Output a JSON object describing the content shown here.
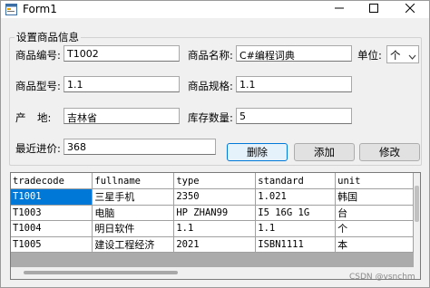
{
  "window": {
    "title": "Form1",
    "icons": {
      "app": "app-icon",
      "minimize": "minimize-icon",
      "maximize": "maximize-icon",
      "close": "close-icon"
    }
  },
  "group": {
    "title": "设置商品信息"
  },
  "form": {
    "code_label": "商品编号:",
    "code_value": "T1002",
    "name_label": "商品名称:",
    "name_value": "C#编程词典",
    "unit_label": "单位:",
    "unit_value": "个",
    "model_label": "商品型号:",
    "model_value": "1.1",
    "spec_label": "商品规格:",
    "spec_value": "1.1",
    "origin_label_1": "产",
    "origin_label_2": "地:",
    "origin_value": "吉林省",
    "stock_label": "库存数量:",
    "stock_value": "5",
    "price_label": "最近进价:",
    "price_value": "368"
  },
  "buttons": {
    "delete": "删除",
    "add": "添加",
    "edit": "修改"
  },
  "grid": {
    "columns": [
      "tradecode",
      "fullname",
      "type",
      "standard",
      "unit"
    ],
    "rows": [
      [
        "T1001",
        "三星手机",
        "2350",
        "1.021",
        "韩国"
      ],
      [
        "T1003",
        "电脑",
        "HP ZHAN99",
        "I5 16G 1G",
        "台"
      ],
      [
        "T1004",
        "明日软件",
        "1.1",
        "1.1",
        "个"
      ],
      [
        "T1005",
        "建设工程经济",
        "2021",
        "ISBN1111",
        "本"
      ]
    ],
    "selected_row": 0
  },
  "watermark": "CSDN @vsnchm"
}
